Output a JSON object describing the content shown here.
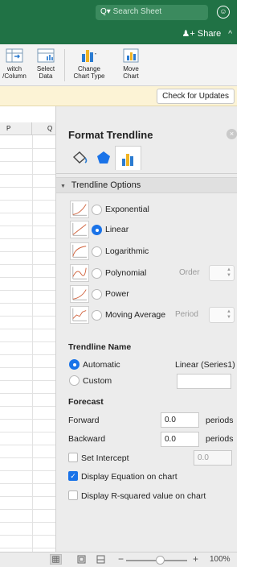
{
  "titlebar": {
    "search_placeholder": "Search Sheet",
    "search_glyph": "Q▾",
    "user_glyph": "☺",
    "color": "#207245"
  },
  "share": {
    "label": "Share",
    "glyph": "♟+"
  },
  "ribbon": {
    "switch_label_1": "witch",
    "switch_label_2": "/Column",
    "select_label_1": "Select",
    "select_label_2": "Data",
    "change_label_1": "Change",
    "change_label_2": "Chart Type",
    "move_label_1": "Move",
    "move_label_2": "Chart"
  },
  "notice": {
    "button_label": "Check for Updates"
  },
  "grid": {
    "columns": [
      "P",
      "Q"
    ]
  },
  "panel": {
    "title": "Format Trendline",
    "section": "Trendline Options",
    "trendline_types": [
      {
        "label": "Exponential",
        "selected": false
      },
      {
        "label": "Linear",
        "selected": true
      },
      {
        "label": "Logarithmic",
        "selected": false
      },
      {
        "label": "Polynomial",
        "selected": false,
        "side_label": "Order"
      },
      {
        "label": "Power",
        "selected": false
      },
      {
        "label": "Moving Average",
        "selected": false,
        "side_label": "Period"
      }
    ],
    "name_heading": "Trendline Name",
    "name_automatic": "Automatic",
    "name_automatic_value": "Linear (Series1)",
    "name_custom": "Custom",
    "name_selected": "Automatic",
    "forecast_heading": "Forecast",
    "forward_label": "Forward",
    "forward_value": "0.0",
    "backward_label": "Backward",
    "backward_value": "0.0",
    "periods_label": "periods",
    "intercept_label": "Set Intercept",
    "intercept_value": "0.0",
    "intercept_checked": false,
    "display_equation_label": "Display Equation on chart",
    "display_equation_checked": true,
    "display_rsquared_label": "Display R-squared value on chart",
    "display_rsquared_checked": false
  },
  "status": {
    "zoom_level": "100%",
    "zoom_fraction": 0.55
  },
  "colors": {
    "accent": "#1a73e8",
    "excel_green": "#207245"
  }
}
